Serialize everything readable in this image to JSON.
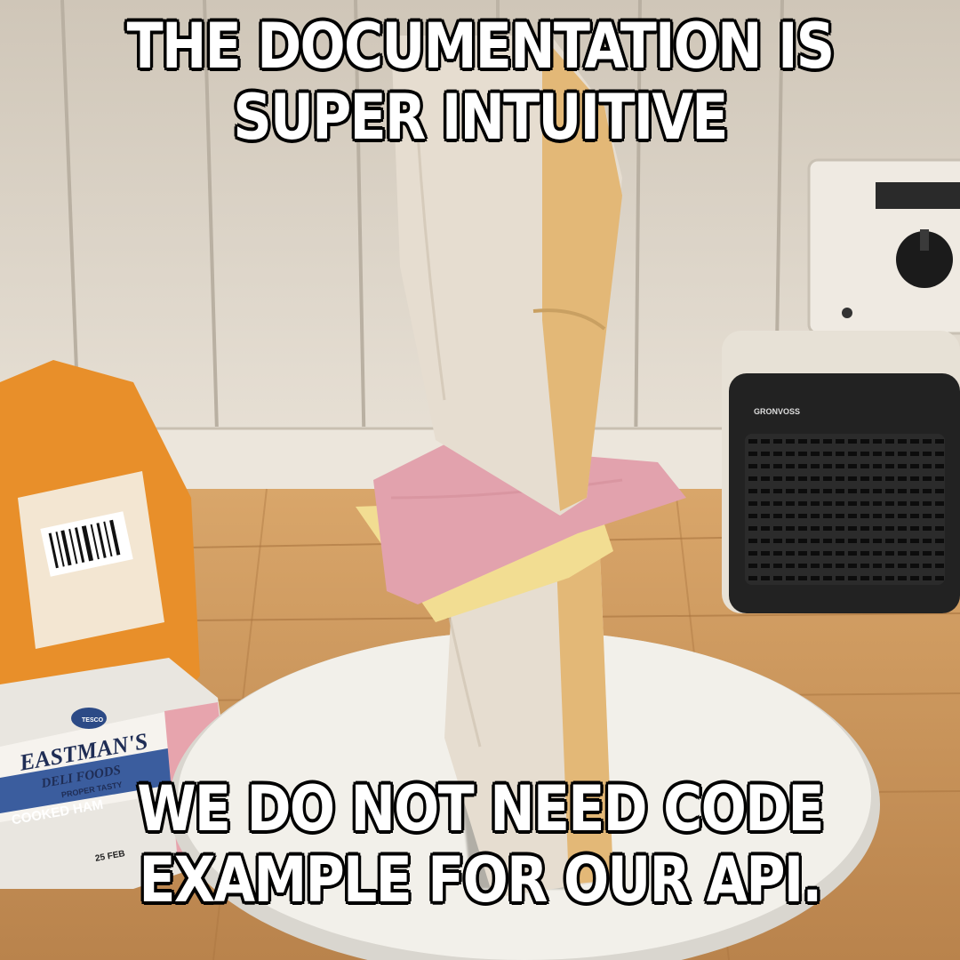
{
  "meme": {
    "top_caption": "THE DOCUMENTATION IS SUPER INTUITIVE",
    "bottom_caption": "WE DO NOT NEED CODE EXAMPLE FOR OUR API."
  },
  "scene": {
    "ham_package": {
      "store": "TESCO",
      "brand": "EASTMAN'S",
      "subbrand": "DELI FOODS",
      "tagline": "PROPER TASTY",
      "product": "COOKED HAM",
      "date": "25 FEB"
    },
    "radio": {
      "brand": "GRONVOSS"
    }
  },
  "colors": {
    "wall": "#ddd4c6",
    "table": "#c8915a",
    "bread_crumb": "#e6ddd0",
    "bread_crust": "#e3b877",
    "ham": "#e2a2ad",
    "cheese": "#f2dd92",
    "plate": "#f2f0ea",
    "caption_fill": "#ffffff",
    "caption_stroke": "#000000"
  }
}
